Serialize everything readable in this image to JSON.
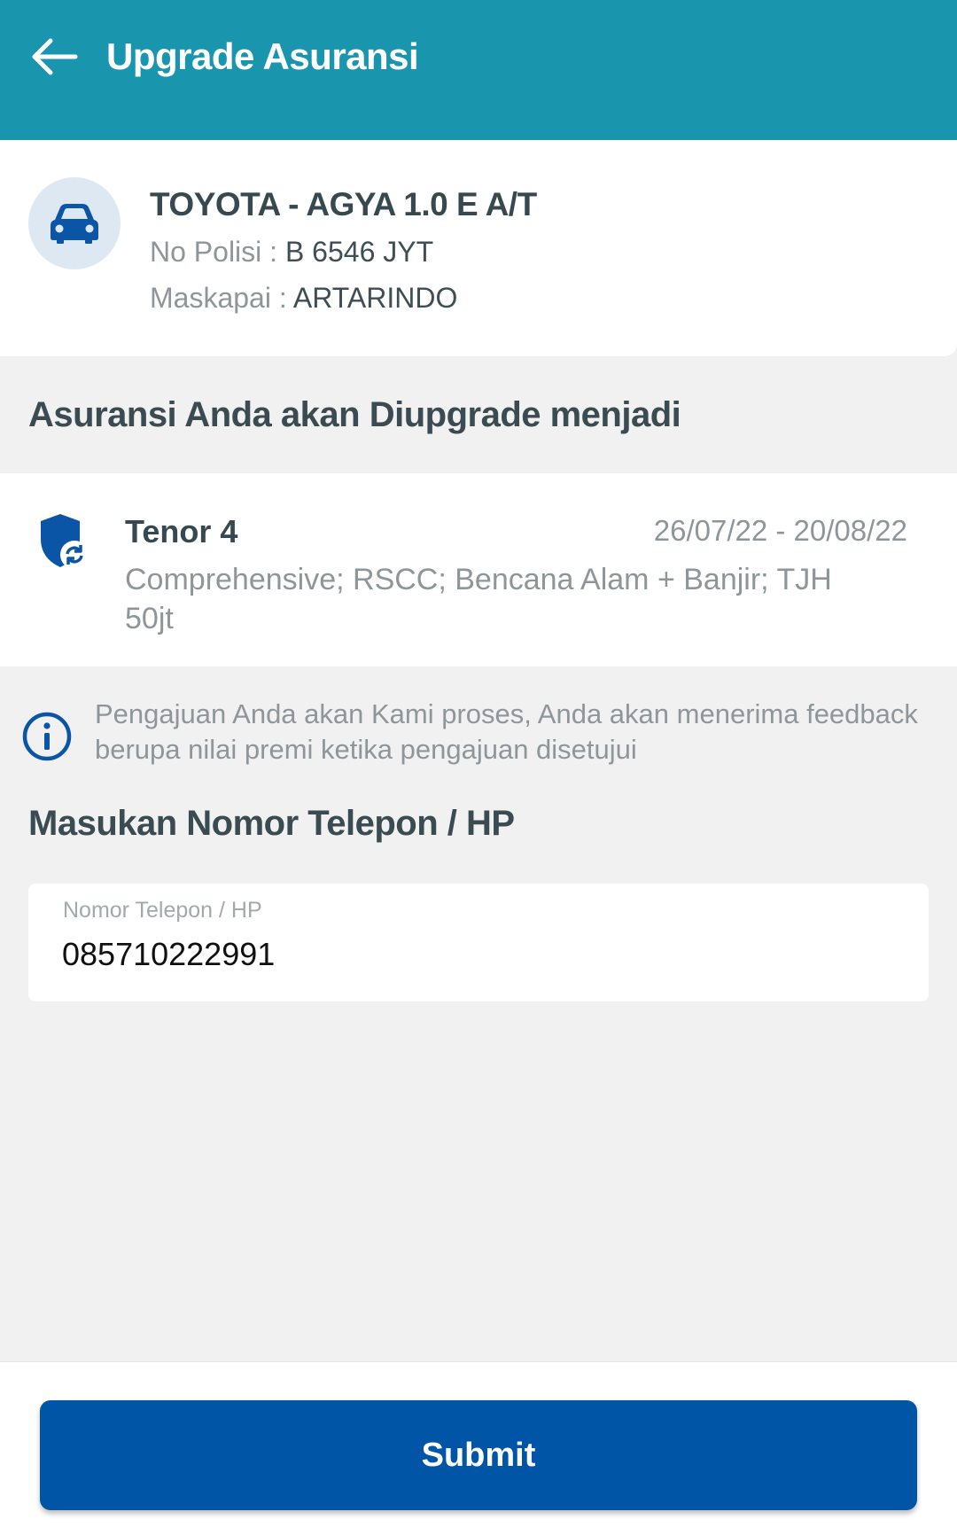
{
  "header": {
    "title": "Upgrade Asuransi",
    "back_icon": "arrow-left-icon",
    "background_color": "#1996ae"
  },
  "vehicle": {
    "icon": "car-icon",
    "name": "TOYOTA - AGYA 1.0 E A/T",
    "policy_label": "No Polisi : ",
    "policy_value": "B 6546 JYT",
    "insurer_label": "Maskapai : ",
    "insurer_value": "ARTARINDO"
  },
  "upgrade_section": {
    "title": "Asuransi Anda akan Diupgrade menjadi"
  },
  "plan": {
    "icon": "shield-refresh-icon",
    "name": "Tenor 4",
    "period": "26/07/22 - 20/08/22",
    "coverage": "Comprehensive; RSCC; Bencana Alam + Banjir; TJH 50jt"
  },
  "notice": {
    "icon": "info-icon",
    "text": "Pengajuan Anda akan Kami proses, Anda akan menerima feedback berupa nilai premi ketika pengajuan disetujui"
  },
  "phone_section": {
    "title": "Masukan Nomor Telepon / HP",
    "field_label": "Nomor Telepon / HP",
    "field_value": "085710222991"
  },
  "footer": {
    "submit_label": "Submit",
    "button_color": "#0155a7"
  }
}
